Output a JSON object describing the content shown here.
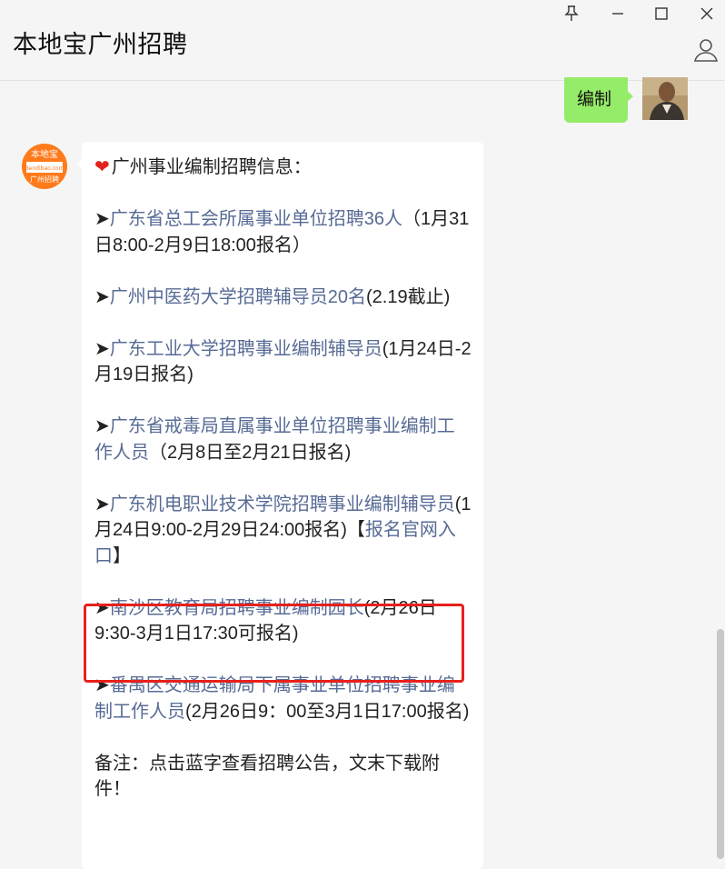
{
  "window": {
    "title": "本地宝广州招聘",
    "pin_icon": "pin-icon",
    "minimize_icon": "minimize-icon",
    "maximize_icon": "maximize-icon",
    "close_icon": "close-icon",
    "profile_icon": "person-icon"
  },
  "sent_message": {
    "text": "编制"
  },
  "received_message": {
    "avatar_text_top": "本地宝",
    "avatar_text_url": "Bendibao.com",
    "avatar_text_bottom": "广州招聘",
    "header": "广州事业编制招聘信息：",
    "items": [
      {
        "arrow": "➤",
        "link": "广东省总工会所属事业单位招聘36人",
        "note": "（1月31日8:00-2月9日18:00报名）"
      },
      {
        "arrow": "➤",
        "link": "广州中医药大学招聘辅导员20名",
        "note": "(2.19截止)"
      },
      {
        "arrow": "➤",
        "link": "广东工业大学招聘事业编制辅导员",
        "note": "(1月24日-2月19日报名)"
      },
      {
        "arrow": "➤",
        "link": "广东省戒毒局直属事业单位招聘事业编制工作人员",
        "note": "（2月8日至2月21日报名)"
      },
      {
        "arrow": "➤",
        "link": "广东机电职业技术学院招聘事业编制辅导员",
        "note": "(1月24日9:00-2月29日24:00报名)【",
        "link2": "报名官网入口",
        "note2": "】"
      },
      {
        "arrow": "➤",
        "link": "南沙区教育局招聘事业编制园长",
        "note": "(2月26日9:30-3月1日17:30可报名)"
      },
      {
        "arrow": "➤",
        "link": "番禺区交通运输局下属事业单位招聘事业编制工作人员",
        "note": "(2月26日9：00至3月1日17:00报名)"
      }
    ],
    "footer": "备注：点击蓝字查看招聘公告，文末下载附件！"
  },
  "colors": {
    "link": "#576b95",
    "sent_bubble": "#95ec69",
    "highlight": "#e8201c",
    "heart": "#e0241b"
  }
}
